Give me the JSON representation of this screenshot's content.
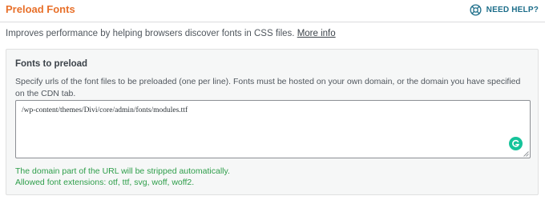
{
  "header": {
    "title": "Preload Fonts",
    "help_label": "NEED HELP?",
    "help_icon": "lifebuoy-icon"
  },
  "description": {
    "text": "Improves performance by helping browsers discover fonts in CSS files.",
    "link_label": "More info"
  },
  "fonts_section": {
    "title": "Fonts to preload",
    "description": "Specify urls of the font files to be preloaded (one per line). Fonts must be hosted on your own domain, or the domain you have specified on the CDN tab.",
    "textarea_value": "/wp-content/themes/Divi/core/admin/fonts/modules.ttf",
    "notes": [
      "The domain part of the URL will be stripped automatically.",
      "Allowed font extensions: otf, ttf, svg, woff, woff2."
    ]
  },
  "colors": {
    "title_accent": "#e8702a",
    "help_accent": "#1d6e8a",
    "note_green": "#2e9e4a",
    "grammarly_green": "#15c39a"
  }
}
